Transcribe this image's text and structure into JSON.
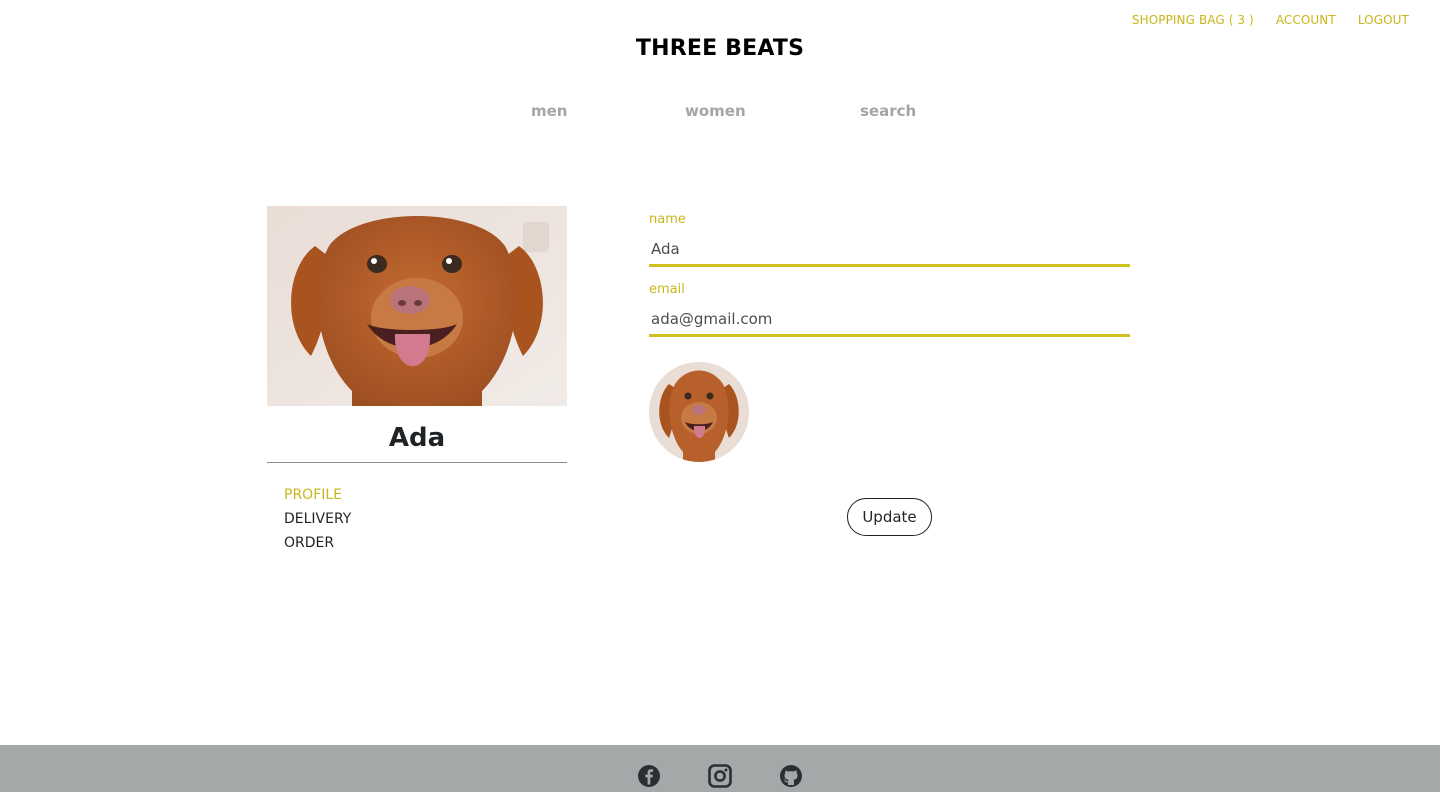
{
  "header": {
    "links": {
      "bag": "SHOPPING BAG ( 3 )",
      "account": "ACCOUNT",
      "logout": "LOGOUT"
    },
    "brand": "THREE BEATS",
    "nav": {
      "men": "men",
      "women": "women",
      "search": "search"
    }
  },
  "sidebar": {
    "user_name": "Ada",
    "menu": [
      "PROFILE",
      "DELIVERY",
      "ORDER"
    ],
    "active_item": "PROFILE"
  },
  "form": {
    "name": {
      "label": "name",
      "value": "Ada"
    },
    "email": {
      "label": "email",
      "value": "ada@gmail.com"
    },
    "update_label": "Update"
  },
  "footer": {
    "icons": [
      "facebook-icon",
      "instagram-icon",
      "github-icon"
    ]
  },
  "colors": {
    "accent": "#c9b61a",
    "input_underline": "#cfc020",
    "nav_text": "#a3a6a8",
    "footer_bg": "#a5a8a9"
  }
}
